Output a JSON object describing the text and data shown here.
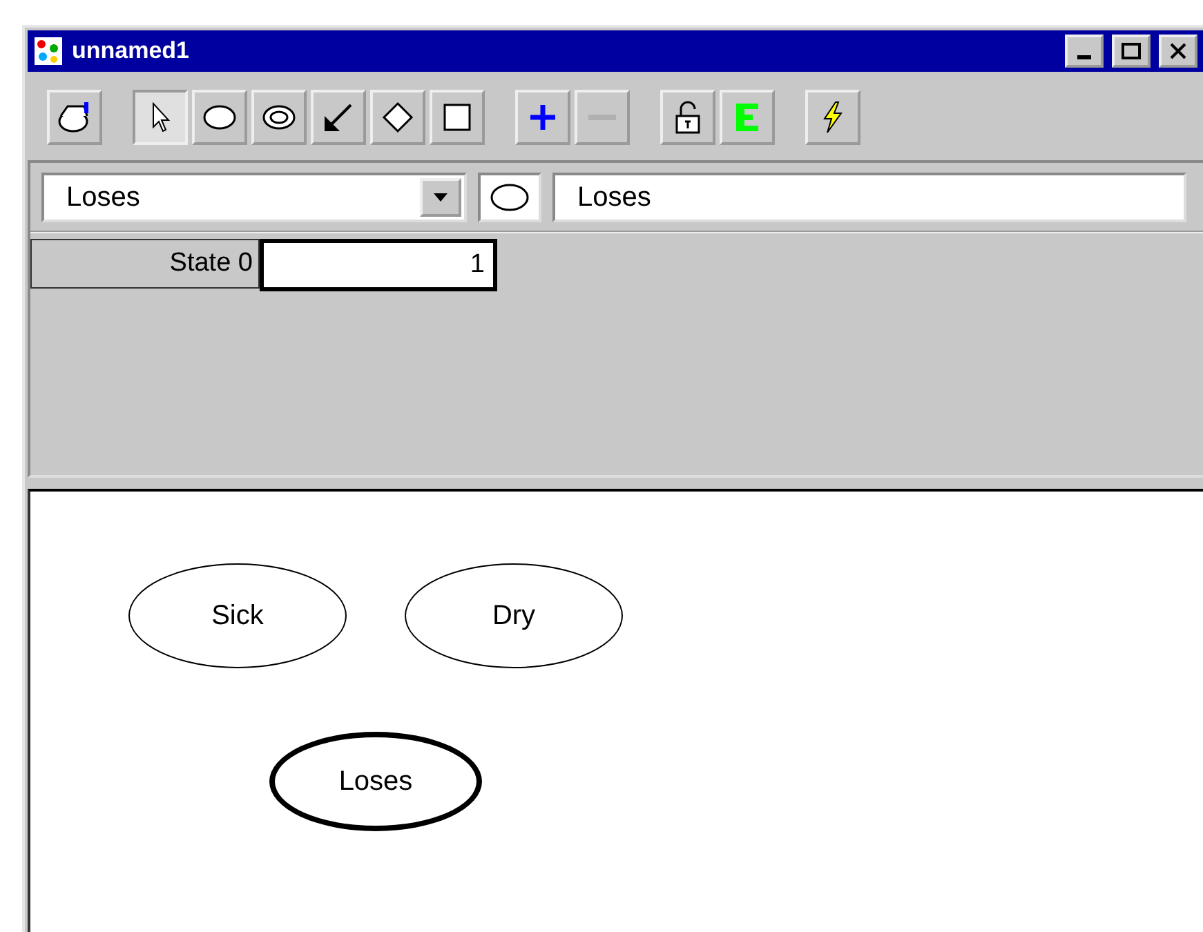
{
  "window": {
    "title": "unnamed1"
  },
  "toolbar": [
    {
      "tools": [
        {
          "kind": "bag",
          "selected": false,
          "disabled": false
        }
      ]
    },
    {
      "tools": [
        {
          "kind": "pointer",
          "selected": true,
          "disabled": false
        },
        {
          "kind": "ellipse",
          "selected": false,
          "disabled": false
        },
        {
          "kind": "double-ellipse",
          "selected": false,
          "disabled": false
        },
        {
          "kind": "arrow",
          "selected": false,
          "disabled": false
        },
        {
          "kind": "diamond",
          "selected": false,
          "disabled": false
        },
        {
          "kind": "square",
          "selected": false,
          "disabled": false
        }
      ]
    },
    {
      "tools": [
        {
          "kind": "plus",
          "selected": false,
          "disabled": false
        },
        {
          "kind": "minus",
          "selected": false,
          "disabled": true
        }
      ]
    },
    {
      "tools": [
        {
          "kind": "lock",
          "selected": false,
          "disabled": false
        },
        {
          "kind": "bars",
          "selected": false,
          "disabled": false
        }
      ]
    },
    {
      "tools": [
        {
          "kind": "bolt",
          "selected": false,
          "disabled": false
        }
      ]
    }
  ],
  "node_panel": {
    "node_select": "Loses",
    "node_name": "Loses",
    "states": [
      {
        "label": "State 0",
        "value": "1"
      }
    ]
  },
  "canvas": {
    "nodes": [
      {
        "label": "Sick",
        "selected": false
      },
      {
        "label": "Dry",
        "selected": false
      },
      {
        "label": "Loses",
        "selected": true
      }
    ]
  }
}
